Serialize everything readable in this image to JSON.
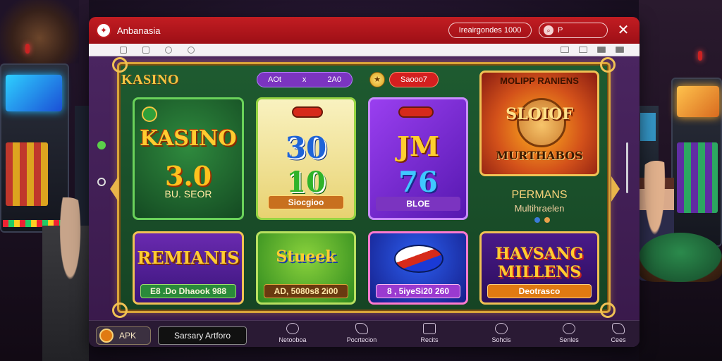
{
  "window": {
    "title": "Anbanasia",
    "header_pill": "Ireairgondes 1000",
    "header_search_placeholder": "P",
    "close_glyph": "✕"
  },
  "brand_title": "KASINO",
  "top_bar": {
    "purple_pill_left": "AOt",
    "purple_pill_mid": "x",
    "purple_pill_right": "2A0",
    "red_pill": "Saooo7"
  },
  "cards": {
    "kasino": {
      "line1": "KASINO",
      "line2": "3.0",
      "sub": "BU. SEOR"
    },
    "gold_slot": {
      "line1": "30",
      "line2": "10",
      "label": "Siocgioo"
    },
    "purple_slot": {
      "line1": "JM",
      "line2": "76",
      "label": "BLOE"
    },
    "feature": {
      "header": "MOLIPP RANIENS",
      "line1": "SLOIOF",
      "line2": "MURTHABOS"
    },
    "remianis": {
      "title": "REMIANIS",
      "label": "E8 .Do Dhaook 988"
    },
    "stueck": {
      "title": "Stueek",
      "label": "AD, 5080s8 2i00"
    },
    "ball": {
      "label": "8 , 5iyeSi20 260"
    },
    "havsang": {
      "line1": "HAVSANG",
      "line2": "MILLENS",
      "label": "Deotrasco"
    }
  },
  "side_promo": {
    "title": "PERMANS",
    "subtitle": "Multihraelen"
  },
  "carousel_dots": [
    "#3a7ad8",
    "#e8a04a"
  ],
  "bottom_bar": {
    "apk_label": "APK",
    "support_label": "Sarsary Artforo",
    "nav": [
      {
        "label": "Netooboa",
        "icon": "globe-icon"
      },
      {
        "label": "Pocrtecion",
        "icon": "shield-icon"
      },
      {
        "label": "Recits",
        "icon": "receipt-icon"
      },
      {
        "label": "Sohcis",
        "icon": "chat-icon"
      },
      {
        "label": "Senles",
        "icon": "refresh-icon"
      },
      {
        "label": "Cees",
        "icon": "cloud-icon"
      }
    ]
  },
  "colors": {
    "titlebar": "#c21d22",
    "frame_gold": "#d9a43a",
    "content_bg": "#4a2560"
  }
}
